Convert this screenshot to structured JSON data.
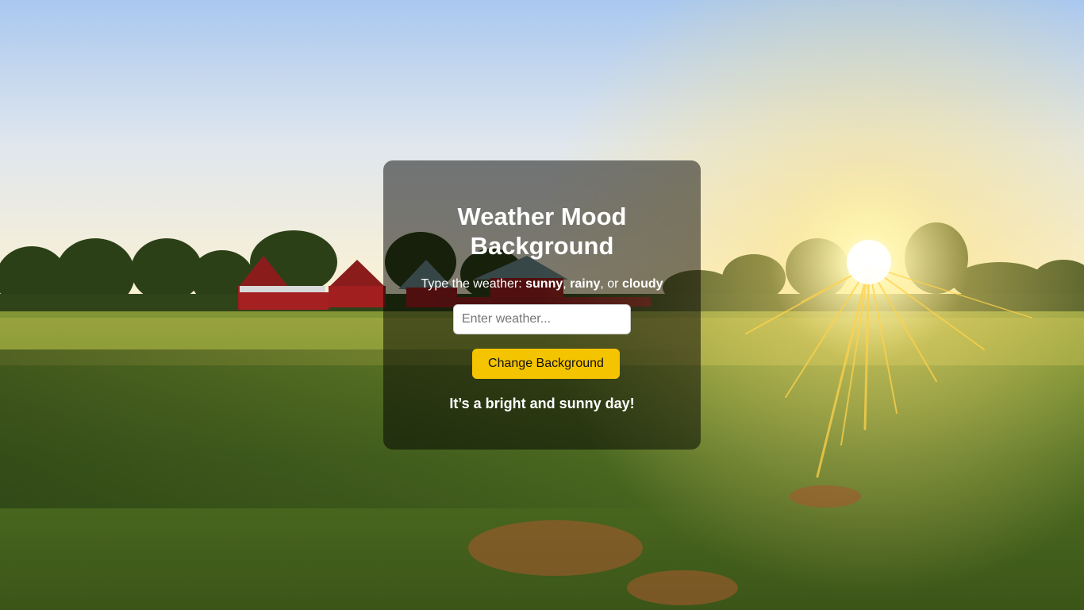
{
  "app": {
    "title": "Weather Mood Background",
    "instructions": {
      "prefix": "Type the weather: ",
      "option_1": "sunny",
      "sep_1": ", ",
      "option_2": "rainy",
      "sep_2": ", or ",
      "option_3": "cloudy"
    },
    "input": {
      "value": "",
      "placeholder": "Enter weather..."
    },
    "button_label": "Change Background",
    "message": "It’s a bright and sunny day!",
    "accent_color": "#f5c400",
    "background_scene": "sunny-farm-field"
  }
}
